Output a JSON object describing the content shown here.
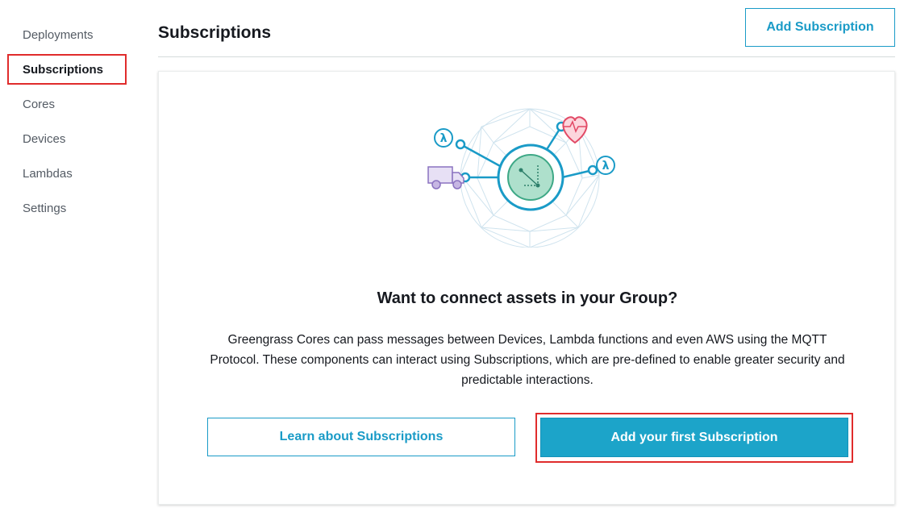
{
  "sidebar": {
    "items": [
      {
        "label": "Deployments"
      },
      {
        "label": "Subscriptions"
      },
      {
        "label": "Cores"
      },
      {
        "label": "Devices"
      },
      {
        "label": "Lambdas"
      },
      {
        "label": "Settings"
      }
    ],
    "active": "Subscriptions"
  },
  "header": {
    "title": "Subscriptions",
    "add_button_label": "Add Subscription"
  },
  "empty_state": {
    "heading": "Want to connect assets in your Group?",
    "description": "Greengrass Cores can pass messages between Devices, Lambda functions and even AWS using the MQTT Protocol. These components can interact using Subscriptions, which are pre-defined to enable greater security and predictable interactions.",
    "illustration_icons": [
      "geodesic-sphere-icon",
      "greengrass-core-icon",
      "lambda-icon",
      "heart-monitor-icon",
      "truck-icon"
    ],
    "illustration_glyphs": {
      "lambda": "λ"
    },
    "learn_button_label": "Learn about Subscriptions",
    "add_first_button_label": "Add your first Subscription"
  },
  "colors": {
    "accent": "#1ca4c9",
    "highlight": "#e02c2c",
    "core_green": "#aee0cc",
    "heart": "#f25f78",
    "truck": "#c6b6e3"
  }
}
